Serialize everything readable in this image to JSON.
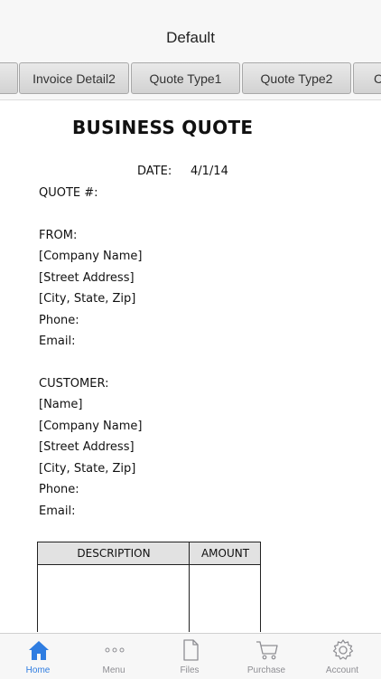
{
  "nav": {
    "title": "Default"
  },
  "tabs": [
    {
      "label": ""
    },
    {
      "label": "Invoice Detail2"
    },
    {
      "label": "Quote Type1"
    },
    {
      "label": "Quote Type2"
    },
    {
      "label": "C"
    }
  ],
  "document": {
    "title": "BUSINESS QUOTE",
    "date_label": "DATE:",
    "date_value": "4/1/14",
    "quote_number_label": "QUOTE #:",
    "from_label": "FROM:",
    "from_lines": [
      "[Company Name]",
      "[Street Address]",
      "[City, State,  Zip]",
      "Phone:",
      "Email:"
    ],
    "customer_label": "CUSTOMER:",
    "customer_lines": [
      "[Name]",
      "[Company Name]",
      "[Street Address]",
      "[City, State,  Zip]",
      "Phone:",
      "Email:"
    ],
    "table_headers": [
      "DESCRIPTION",
      "AMOUNT"
    ]
  },
  "tabbar": {
    "items": [
      {
        "label": "Home",
        "icon": "home-icon",
        "active": true
      },
      {
        "label": "Menu",
        "icon": "more-icon",
        "active": false
      },
      {
        "label": "Files",
        "icon": "file-icon",
        "active": false
      },
      {
        "label": "Purchase",
        "icon": "cart-icon",
        "active": false
      },
      {
        "label": "Account",
        "icon": "gear-icon",
        "active": false
      }
    ]
  },
  "colors": {
    "accent": "#2f7de1",
    "inactive": "#8e8e93",
    "bar_background": "#f7f7f7",
    "table_header": "#e2e2e2"
  }
}
